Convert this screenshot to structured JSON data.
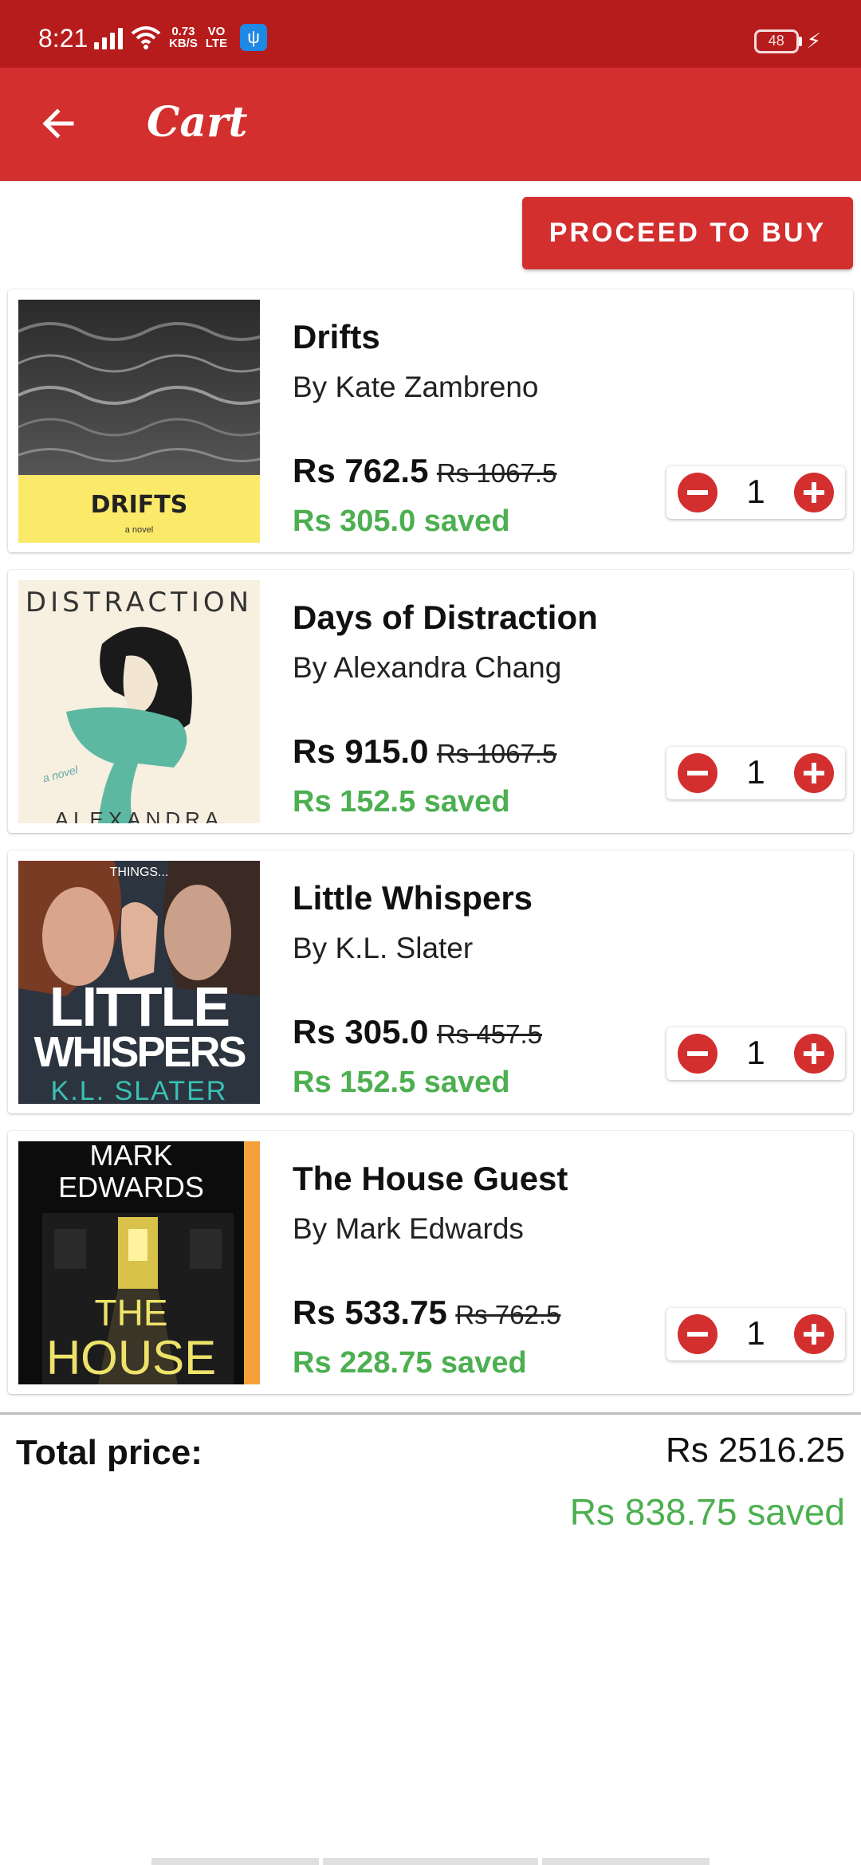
{
  "status_bar": {
    "time": "8:21",
    "net_speed_top": "0.73",
    "net_speed_bottom": "KB/S",
    "volte_top": "VO",
    "volte_bottom": "LTE",
    "usb_icon": "usb-icon",
    "battery": "48"
  },
  "app_bar": {
    "title": "Cart",
    "back_icon": "arrow-left-icon"
  },
  "proceed_button": "PROCEED TO BUY",
  "items": [
    {
      "title": "Drifts",
      "author": "By Kate Zambreno",
      "price": "Rs 762.5",
      "original_price": "Rs 1067.5",
      "saved": "Rs 305.0 saved",
      "quantity": "1",
      "cover_text": "DRIFTS",
      "cover_subtext": "a novel"
    },
    {
      "title": "Days of Distraction",
      "author": "By Alexandra Chang",
      "price": "Rs 915.0",
      "original_price": "Rs 1067.5",
      "saved": "Rs 152.5 saved",
      "quantity": "1",
      "cover_text": "DISTRACTION",
      "cover_subtext": "a novel",
      "cover_author": "ALEXANDRA"
    },
    {
      "title": "Little Whispers",
      "author": "By K.L. Slater",
      "price": "Rs 305.0",
      "original_price": "Rs 457.5",
      "saved": "Rs 152.5 saved",
      "quantity": "1",
      "cover_text_top": "THINGS...",
      "cover_text_1": "LITTLE",
      "cover_text_2": "WHISPERS",
      "cover_author": "K.L. SLATER"
    },
    {
      "title": "The House Guest",
      "author": "By Mark Edwards",
      "price": "Rs 533.75",
      "original_price": "Rs 762.5",
      "saved": "Rs 228.75 saved",
      "quantity": "1",
      "cover_author_1": "MARK",
      "cover_author_2": "EDWARDS",
      "cover_text_1": "THE",
      "cover_text_2": "HOUSE"
    }
  ],
  "totals": {
    "label": "Total price:",
    "value": "Rs 2516.25",
    "saved": "Rs 838.75 saved"
  },
  "colors": {
    "status_bar": "#b71c1c",
    "primary": "#d32f2f",
    "saved_green": "#4caf50"
  }
}
